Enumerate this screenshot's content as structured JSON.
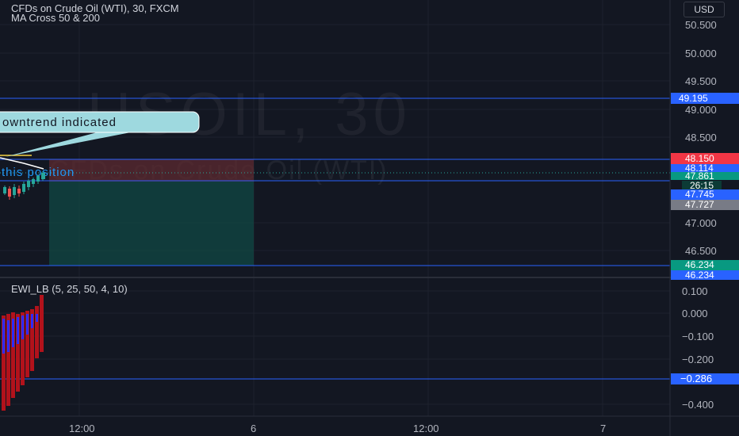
{
  "header": {
    "symbol_title": "CFDs on Crude Oil (WTI), 30, FXCM",
    "indicator_ma": "MA Cross 50 & 200",
    "currency": "USD"
  },
  "watermark": {
    "line1": "USOIL, 30",
    "line2": "CFDs on Crude Oil (WTI)"
  },
  "annotations": {
    "callout_text": "owntrend indicated",
    "position_text": "this position"
  },
  "price_axis": {
    "ticks": [
      "50.500",
      "50.000",
      "49.500",
      "49.000",
      "48.500",
      "47.000",
      "46.500"
    ]
  },
  "price_labels": [
    {
      "name": "level-49-195",
      "text": "49.195",
      "color": "#2962ff"
    },
    {
      "name": "level-48-150",
      "text": "48.150",
      "color": "#f23645"
    },
    {
      "name": "level-48-114",
      "text": "48.114",
      "color": "#2962ff"
    },
    {
      "name": "level-47-861",
      "text": "47.861",
      "color": "#089981"
    },
    {
      "name": "countdown",
      "text": "26:15",
      "color": "#089981"
    },
    {
      "name": "level-47-745",
      "text": "47.745",
      "color": "#2962ff"
    },
    {
      "name": "level-47-727",
      "text": "47.727",
      "color": "#787b86"
    },
    {
      "name": "level-46-234-a",
      "text": "46.234",
      "color": "#089981"
    },
    {
      "name": "level-46-234-b",
      "text": "46.234",
      "color": "#2962ff"
    }
  ],
  "indicator": {
    "title": "EWI_LB (5, 25, 50, 4, 10)",
    "ticks": [
      "0.100",
      "0.000",
      "−0.100",
      "−0.200",
      "−0.400"
    ],
    "level_label": "−0.286",
    "level_color": "#2962ff"
  },
  "time_axis": {
    "ticks": [
      "12:00",
      "6",
      "12:00",
      "7"
    ]
  },
  "colors": {
    "background": "#131722",
    "up_candle": "#26a69a",
    "down_candle": "#ef5350",
    "line_blue": "#2962ff",
    "position_green": "#0f4c46",
    "position_red": "#5c2a30",
    "callout_teal": "#9ed9df",
    "bar_red": "#b2121b",
    "bar_blue": "#2b2cff"
  }
}
